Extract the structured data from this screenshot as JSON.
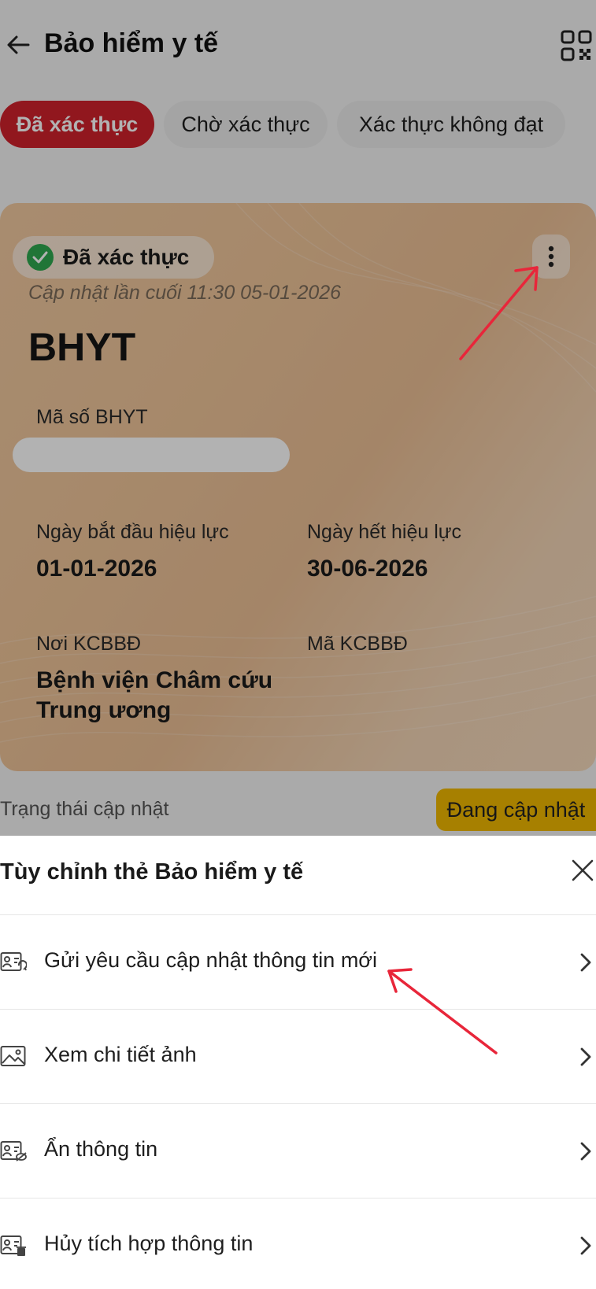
{
  "header": {
    "title": "Bảo hiểm y tế"
  },
  "tabs": [
    {
      "label": "Đã xác thực",
      "active": true
    },
    {
      "label": "Chờ xác thực",
      "active": false
    },
    {
      "label": "Xác thực không đạt",
      "active": false
    }
  ],
  "card": {
    "status": "Đã xác thực",
    "last_update": "Cập nhật lần cuối 11:30 05-01-2026",
    "title": "BHYT",
    "id_label": "Mã số BHYT",
    "start_label": "Ngày bắt đầu hiệu lực",
    "start_value": "01-01-2026",
    "end_label": "Ngày hết hiệu lực",
    "end_value": "30-06-2026",
    "place_label": "Nơi KCBBĐ",
    "place_value_line1": "Bệnh viện Châm cứu",
    "place_value_line2": "Trung ương",
    "code_label": "Mã KCBBĐ"
  },
  "update_status": {
    "label": "Trạng thái cập nhật",
    "badge": "Đang cập nhật"
  },
  "sheet": {
    "title": "Tùy chỉnh thẻ Bảo hiểm y tế",
    "items": [
      {
        "label": "Gửi yêu cầu cập nhật thông tin mới"
      },
      {
        "label": "Xem chi tiết ảnh"
      },
      {
        "label": "Ẩn thông tin"
      },
      {
        "label": "Hủy tích hợp thông tin"
      }
    ]
  },
  "colors": {
    "accent": "#d0212c",
    "verified": "#2fa84f",
    "badge": "#f0b800",
    "annotation": "#e8263a"
  }
}
